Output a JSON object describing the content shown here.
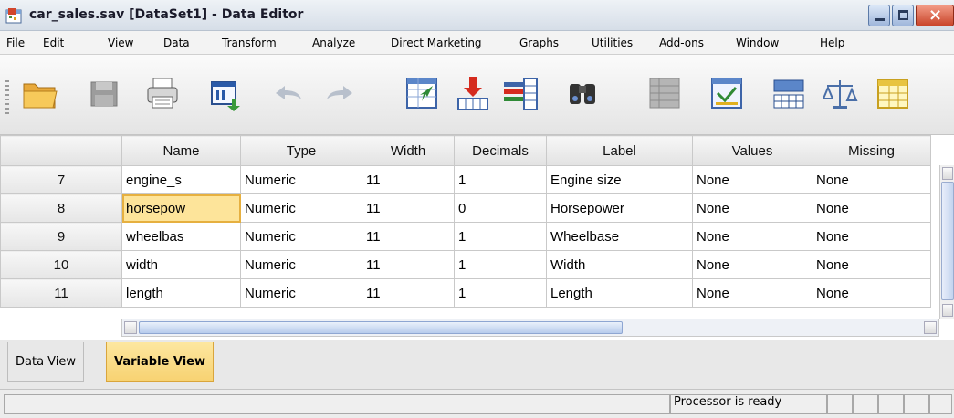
{
  "window": {
    "title": "car_sales.sav [DataSet1] - Data Editor",
    "close_glyph": "×"
  },
  "menu": [
    "File",
    "Edit",
    "View",
    "Data",
    "Transform",
    "Analyze",
    "Direct Marketing",
    "Graphs",
    "Utilities",
    "Add-ons",
    "Window",
    "Help"
  ],
  "toolbar": {
    "icons": [
      "open-folder-icon",
      "save-icon",
      "print-icon",
      "dialog-recall-icon",
      "undo-icon",
      "redo-icon",
      "go-to-case-icon",
      "go-to-variable-icon",
      "variables-icon",
      "find-icon",
      "insert-cases-icon",
      "insert-variable-icon",
      "split-file-icon",
      "weight-cases-icon",
      "select-cases-icon"
    ]
  },
  "grid": {
    "columns": [
      "Name",
      "Type",
      "Width",
      "Decimals",
      "Label",
      "Values",
      "Missing"
    ],
    "rows": [
      {
        "num": "7",
        "cells": [
          "engine_s",
          "Numeric",
          "11",
          "1",
          "Engine size",
          "None",
          "None"
        ]
      },
      {
        "num": "8",
        "cells": [
          "horsepow",
          "Numeric",
          "11",
          "0",
          "Horsepower",
          "None",
          "None"
        ]
      },
      {
        "num": "9",
        "cells": [
          "wheelbas",
          "Numeric",
          "11",
          "1",
          "Wheelbase",
          "None",
          "None"
        ]
      },
      {
        "num": "10",
        "cells": [
          "width",
          "Numeric",
          "11",
          "1",
          "Width",
          "None",
          "None"
        ]
      },
      {
        "num": "11",
        "cells": [
          "length",
          "Numeric",
          "11",
          "1",
          "Length",
          "None",
          "None"
        ]
      }
    ],
    "selected_row": 1,
    "selected_col": 0
  },
  "tabs": [
    {
      "label": "Data View",
      "active": false
    },
    {
      "label": "Variable View",
      "active": true
    }
  ],
  "status": {
    "text": "Processor is ready"
  },
  "colors": {
    "selected_cell": "#fde49a",
    "active_tab": "#f7d271"
  }
}
